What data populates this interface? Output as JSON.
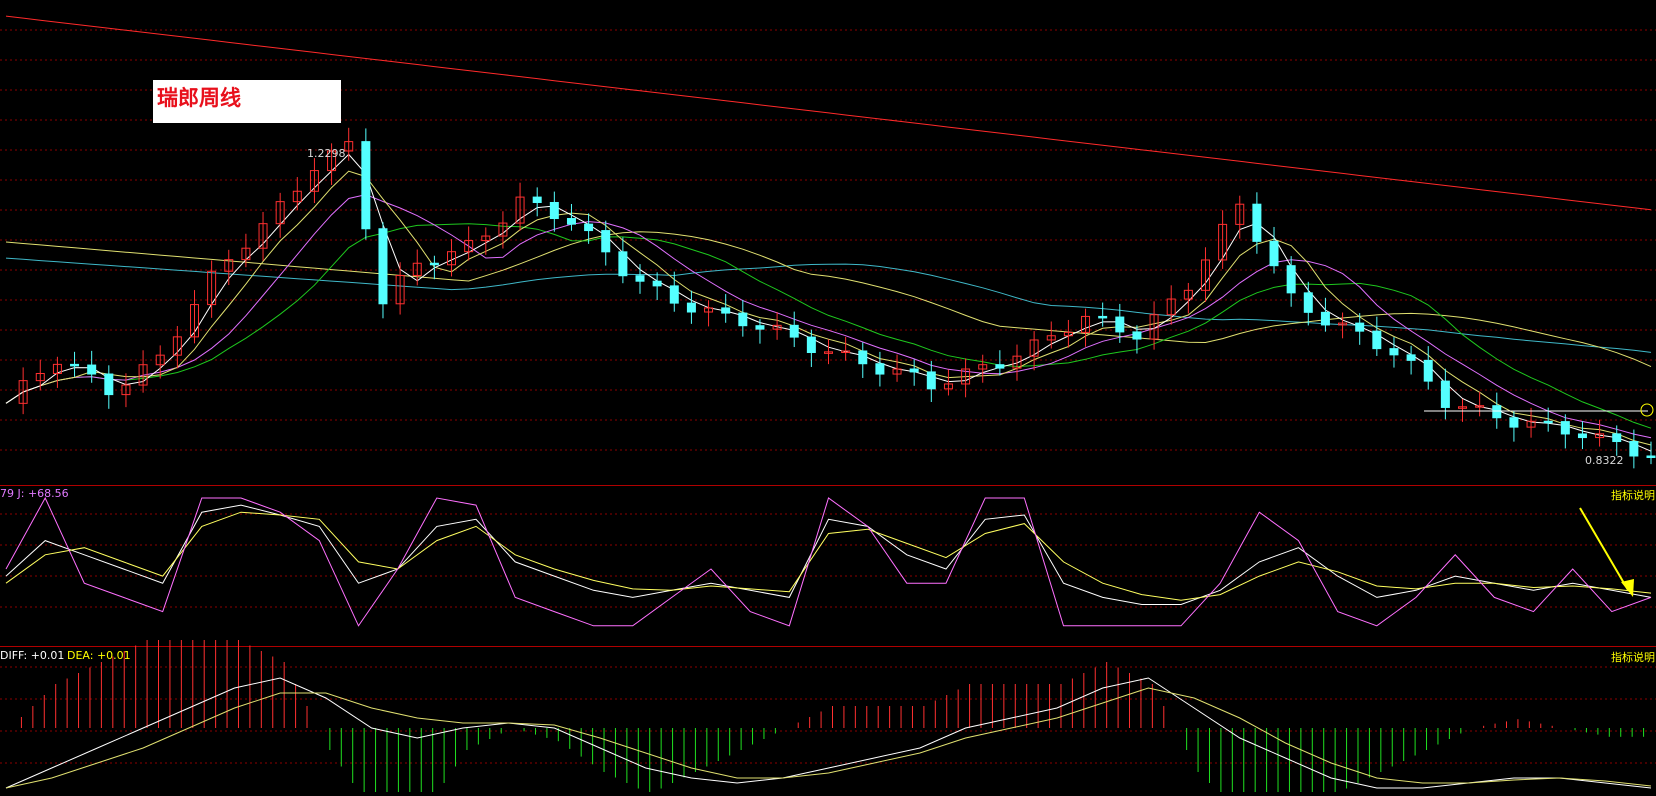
{
  "title": "瑞郎周线",
  "price_panel": {
    "high_label": "1.2298",
    "low_label": "0.8322"
  },
  "kdj_panel": {
    "label": "79 J: +68.56",
    "help_label": "指标说明"
  },
  "macd_panel": {
    "diff_label": "DIFF: +0.01",
    "dea_label": "DEA: +0.01",
    "help_label": "指标说明"
  },
  "colors": {
    "background": "#000000",
    "up_candle": "#ff3030",
    "down_candle": "#54ffff",
    "grid": "#8b0000",
    "ma_long": "#ff2a2a",
    "ma_cyan": "#3fb8c8",
    "ma_yellow": "#e0e070",
    "ma_green": "#1ec81e",
    "ma_magenta": "#e070ff",
    "ma_white": "#ffffff",
    "kdj_k": "#ffffff",
    "kdj_d": "#ffff60",
    "kdj_j": "#ff70ff",
    "macd_pos": "#ff3030",
    "macd_neg": "#20e020",
    "annotation_arrow": "#ffff00"
  },
  "chart_data": [
    {
      "type": "candlestick",
      "title": "瑞郎周线",
      "ylim": [
        0.8,
        1.4
      ],
      "annotations": [
        "1.2298",
        "0.8322"
      ],
      "key_points": {
        "high": 1.2298,
        "low": 0.8322
      },
      "close_path": [
        [
          0,
          0.9
        ],
        [
          3,
          0.95
        ],
        [
          6,
          0.92
        ],
        [
          9,
          0.96
        ],
        [
          12,
          1.05
        ],
        [
          15,
          1.12
        ],
        [
          18,
          1.2
        ],
        [
          20,
          1.22
        ],
        [
          22,
          1.02
        ],
        [
          24,
          1.07
        ],
        [
          27,
          1.1
        ],
        [
          30,
          1.15
        ],
        [
          33,
          1.12
        ],
        [
          36,
          1.07
        ],
        [
          39,
          1.03
        ],
        [
          42,
          1.0
        ],
        [
          45,
          0.99
        ],
        [
          48,
          0.97
        ],
        [
          51,
          0.94
        ],
        [
          54,
          0.92
        ],
        [
          57,
          0.95
        ],
        [
          60,
          0.97
        ],
        [
          63,
          1.0
        ],
        [
          66,
          0.99
        ],
        [
          69,
          1.05
        ],
        [
          72,
          1.14
        ],
        [
          75,
          1.03
        ],
        [
          78,
          1.0
        ],
        [
          81,
          0.96
        ],
        [
          84,
          0.9
        ],
        [
          87,
          0.89
        ],
        [
          90,
          0.87
        ],
        [
          93,
          0.85
        ],
        [
          96,
          0.84
        ]
      ]
    },
    {
      "type": "line",
      "title": "KDJ",
      "ylim": [
        0,
        100
      ],
      "series": [
        {
          "values": [
            45,
            70,
            60,
            50,
            40,
            90,
            95,
            88,
            80,
            40,
            50,
            80,
            85,
            55,
            45,
            35,
            30,
            35,
            40,
            35,
            30,
            85,
            80,
            60,
            50,
            85,
            88,
            40,
            30,
            25,
            25,
            35,
            55,
            65,
            45,
            30,
            35,
            45,
            40,
            35,
            40,
            35,
            30
          ]
        },
        {
          "values": [
            40,
            60,
            65,
            55,
            45,
            80,
            90,
            88,
            85,
            55,
            50,
            70,
            80,
            60,
            50,
            42,
            36,
            35,
            38,
            36,
            34,
            75,
            78,
            68,
            58,
            75,
            82,
            55,
            40,
            32,
            28,
            32,
            45,
            55,
            48,
            38,
            36,
            40,
            40,
            37,
            38,
            36,
            33
          ]
        },
        {
          "name": "J",
          "values": [
            50,
            100,
            40,
            30,
            20,
            100,
            100,
            90,
            70,
            10,
            50,
            100,
            95,
            30,
            20,
            10,
            10,
            30,
            50,
            20,
            10,
            100,
            80,
            40,
            40,
            100,
            100,
            10,
            10,
            10,
            10,
            40,
            90,
            70,
            20,
            10,
            30,
            60,
            30,
            20,
            50,
            20,
            30
          ]
        }
      ]
    },
    {
      "type": "bar",
      "title": "MACD",
      "series": [
        {
          "name": "DIFF",
          "values": [
            -0.06,
            -0.04,
            -0.02,
            0.0,
            0.02,
            0.04,
            0.05,
            0.03,
            0.0,
            -0.01,
            0.0,
            0.005,
            0.0,
            -0.02,
            -0.04,
            -0.05,
            -0.055,
            -0.05,
            -0.04,
            -0.03,
            -0.02,
            0.0,
            0.01,
            0.02,
            0.04,
            0.05,
            0.02,
            -0.01,
            -0.03,
            -0.05,
            -0.06,
            -0.06,
            -0.055,
            -0.05,
            -0.05,
            -0.055,
            -0.06
          ]
        },
        {
          "name": "DEA",
          "values": [
            -0.06,
            -0.05,
            -0.035,
            -0.02,
            0.0,
            0.02,
            0.035,
            0.035,
            0.02,
            0.01,
            0.005,
            0.005,
            0.003,
            -0.01,
            -0.025,
            -0.04,
            -0.05,
            -0.05,
            -0.045,
            -0.035,
            -0.025,
            -0.01,
            0.0,
            0.01,
            0.025,
            0.04,
            0.03,
            0.01,
            -0.015,
            -0.035,
            -0.05,
            -0.055,
            -0.055,
            -0.052,
            -0.05,
            -0.053,
            -0.058
          ]
        }
      ]
    }
  ]
}
